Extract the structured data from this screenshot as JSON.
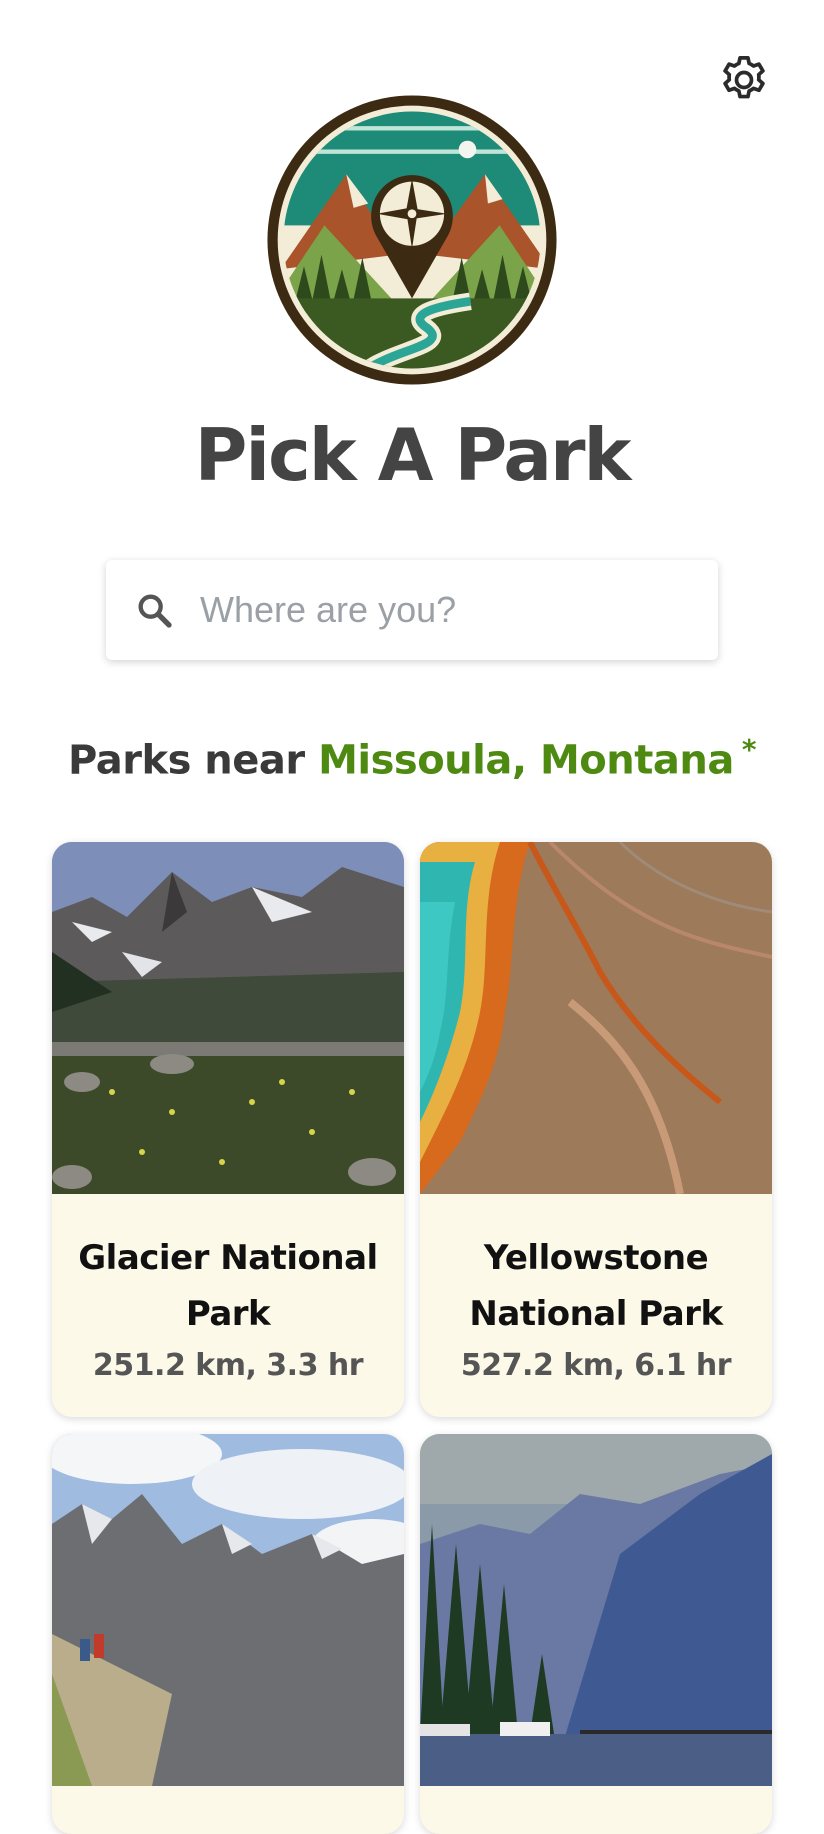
{
  "app": {
    "title": "Pick A Park"
  },
  "icons": {
    "settings": "gear-icon",
    "search": "search-icon",
    "logo": "park-compass-logo"
  },
  "search": {
    "placeholder": "Where are you?",
    "value": ""
  },
  "nearby": {
    "prefix": "Parks near",
    "location": "Missoula, Montana",
    "asterisk": "*"
  },
  "colors": {
    "accent_green": "#4e8a12",
    "card_background": "#fcf9e9",
    "title_gray": "#444444"
  },
  "parks": [
    {
      "name": "Glacier National Park",
      "distance": "251.2 km, 3.3 hr",
      "photo": "mountain-meadow"
    },
    {
      "name": "Yellowstone National Park",
      "distance": "527.2 km, 6.1 hr",
      "photo": "hot-spring"
    },
    {
      "name": "",
      "distance": "",
      "photo": "rocky-peaks-hikers"
    },
    {
      "name": "",
      "distance": "",
      "photo": "alpine-lake"
    }
  ]
}
